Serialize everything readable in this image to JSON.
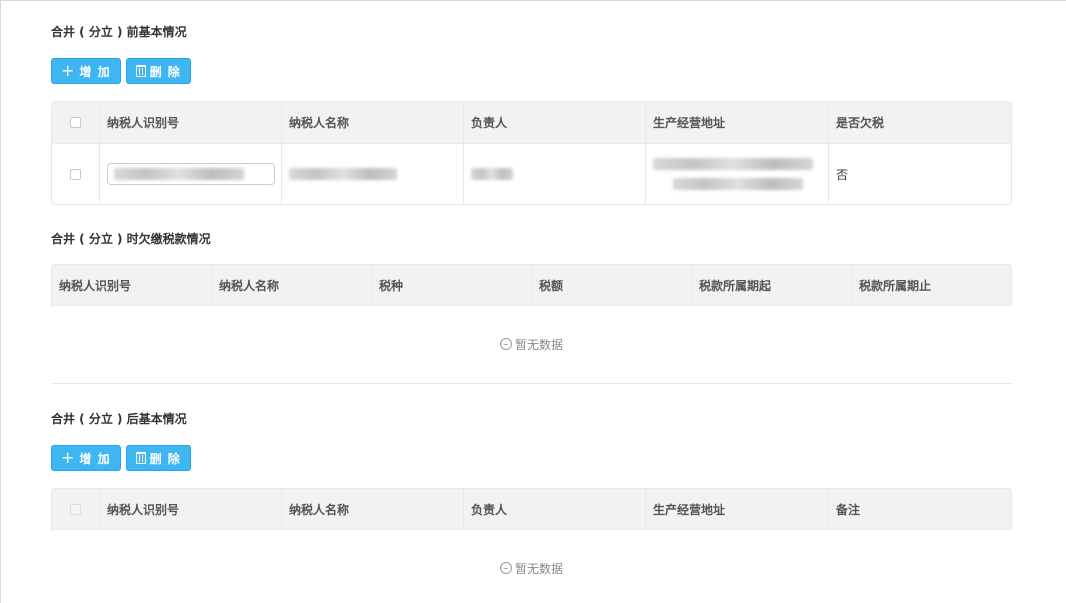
{
  "section1": {
    "title": "合井 ( 分立 ) 前基本情况",
    "add_label": "增 加",
    "delete_label": "删 除",
    "columns": [
      "纳税人识别号",
      "纳税人名称",
      "负责人",
      "生产经营地址",
      "是否欠税"
    ],
    "rows": [
      {
        "owes_tax": "否"
      }
    ]
  },
  "section2": {
    "title": "合井 ( 分立 ) 时欠缴税款情况",
    "columns": [
      "纳税人识别号",
      "纳税人名称",
      "税种",
      "税额",
      "税款所属期起",
      "税款所属期止"
    ],
    "empty_text": "暂无数据"
  },
  "section3": {
    "title": "合井 ( 分立 ) 后基本情况",
    "add_label": "增 加",
    "delete_label": "删 除",
    "columns": [
      "纳税人识别号",
      "纳税人名称",
      "负责人",
      "生产经营地址",
      "备注"
    ],
    "empty_text": "暂无数据"
  },
  "colors": {
    "accent": "#3db6f2",
    "header_bg": "#f2f2f2"
  },
  "icons": {
    "add": "plus-icon",
    "delete": "trash-icon",
    "empty": "frown-icon"
  }
}
